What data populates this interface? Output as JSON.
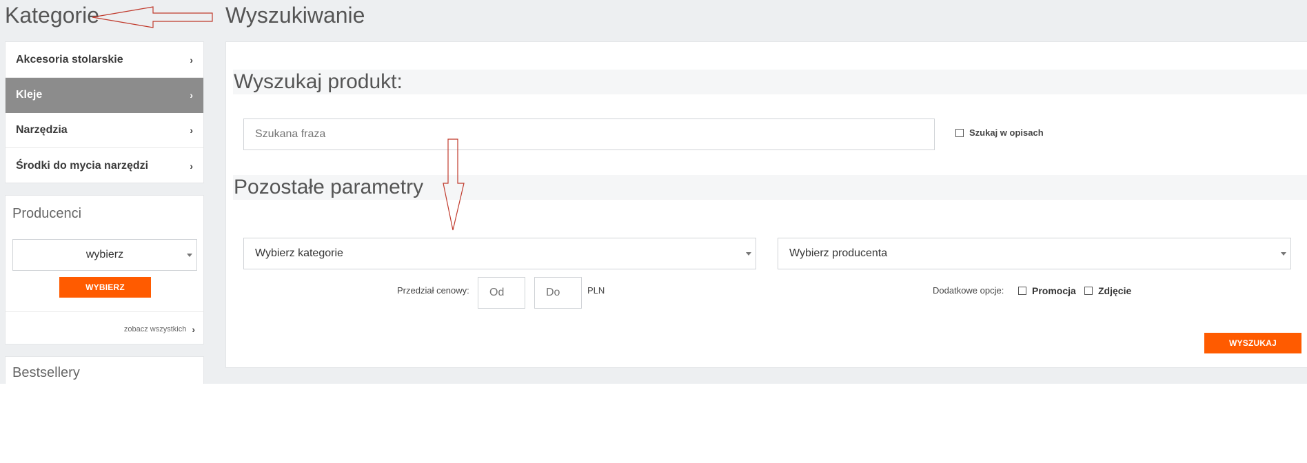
{
  "sidebar": {
    "title": "Kategorie",
    "categories": [
      {
        "label": "Akcesoria stolarskie",
        "active": false
      },
      {
        "label": "Kleje",
        "active": true
      },
      {
        "label": "Narzędzia",
        "active": false
      },
      {
        "label": "Środki do mycia narzędzi",
        "active": false
      }
    ],
    "chevron": "›",
    "producers": {
      "title": "Producenci",
      "select_value": "wybierz",
      "button_label": "WYBIERZ",
      "see_all_label": "zobacz wszystkich",
      "see_all_chevron": "›"
    },
    "bestsellers": {
      "title": "Bestsellery"
    }
  },
  "main": {
    "title": "Wyszukiwanie",
    "search_section": {
      "title": "Wyszukaj produkt:",
      "search_placeholder": "Szukana fraza",
      "search_in_descriptions_label": "Szukaj w opisach"
    },
    "params_section": {
      "title": "Pozostałe parametry",
      "category_select": "Wybierz kategorie",
      "producer_select": "Wybierz producenta",
      "price_range_label": "Przedział cenowy:",
      "price_from_placeholder": "Od",
      "price_to_placeholder": "Do",
      "currency": "PLN",
      "extra_options_label": "Dodatkowe opcje:",
      "option_promotion": "Promocja",
      "option_photo": "Zdjęcie"
    },
    "search_button": "WYSZUKAJ"
  },
  "colors": {
    "accent": "#ff5b00",
    "active_category": "#8c8c8c",
    "background": "#edeff1",
    "annotation_arrow": "#c0392b"
  },
  "icons": [
    "chevron-right-icon",
    "caret-down-icon",
    "checkbox-icon",
    "annotation-arrow-icon"
  ]
}
